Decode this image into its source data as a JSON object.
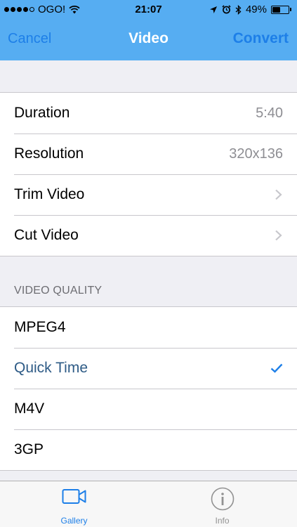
{
  "status_bar": {
    "carrier": "OGO!",
    "time": "21:07",
    "battery_percent": "49%",
    "battery_level": 0.49,
    "signal_bars_filled": 4,
    "signal_bars_total": 5
  },
  "navbar": {
    "cancel_label": "Cancel",
    "title": "Video",
    "convert_label": "Convert"
  },
  "info": {
    "items": [
      {
        "label": "Duration",
        "value": "5:40"
      },
      {
        "label": "Resolution",
        "value": "320x136"
      },
      {
        "label": "Trim Video"
      },
      {
        "label": "Cut Video"
      }
    ]
  },
  "quality": {
    "header": "VIDEO QUALITY",
    "selected": "Quick Time",
    "options": [
      "MPEG4",
      "Quick Time",
      "M4V",
      "3GP"
    ]
  },
  "tabbar": {
    "gallery_label": "Gallery",
    "info_label": "Info"
  },
  "colors": {
    "header_bg": "#56adf2",
    "accent": "#1d7fe8",
    "selected_text": "#2e5b86"
  }
}
